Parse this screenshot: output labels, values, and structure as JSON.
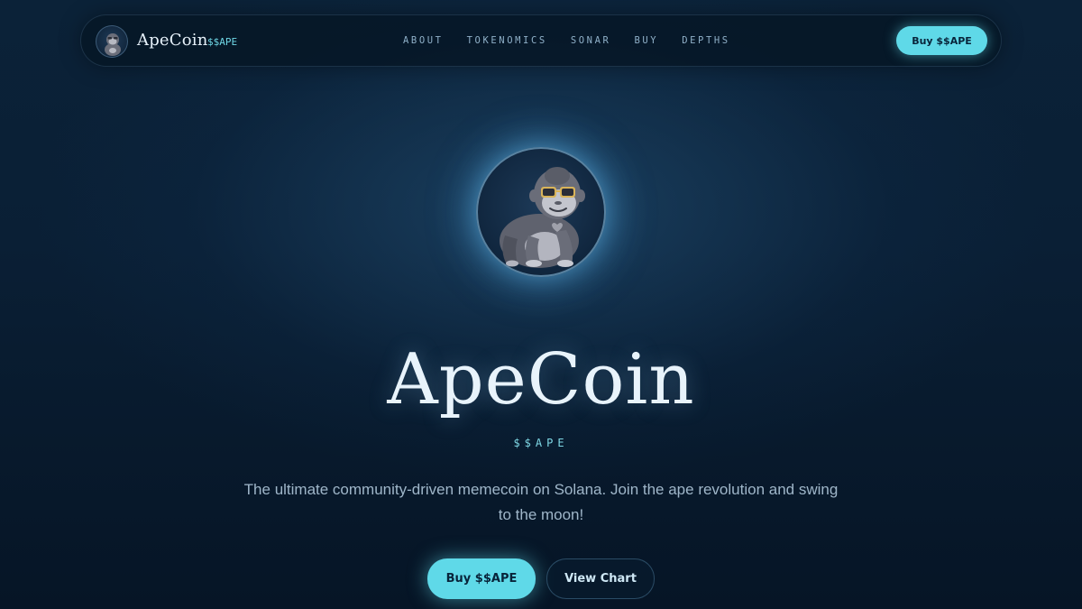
{
  "nav": {
    "brand": "ApeCoin",
    "ticker": "$$APE",
    "links": [
      "ABOUT",
      "TOKENOMICS",
      "SONAR",
      "BUY",
      "DEPTHS"
    ],
    "cta_label": "Buy $$APE",
    "logo_icon": "gorilla-icon"
  },
  "hero": {
    "avatar_icon": "gorilla-with-sunglasses-icon",
    "title": "ApeCoin",
    "ticker": "$$APE",
    "description": "The ultimate community-driven memecoin on Solana. Join the ape revolution and swing to the moon!",
    "primary_button": "Buy $$APE",
    "secondary_button": "View Chart"
  },
  "colors": {
    "accent": "#5fd9e8",
    "background": "#0a1f35",
    "title": "#e8f3fb",
    "muted_text": "#9fb6c9"
  }
}
